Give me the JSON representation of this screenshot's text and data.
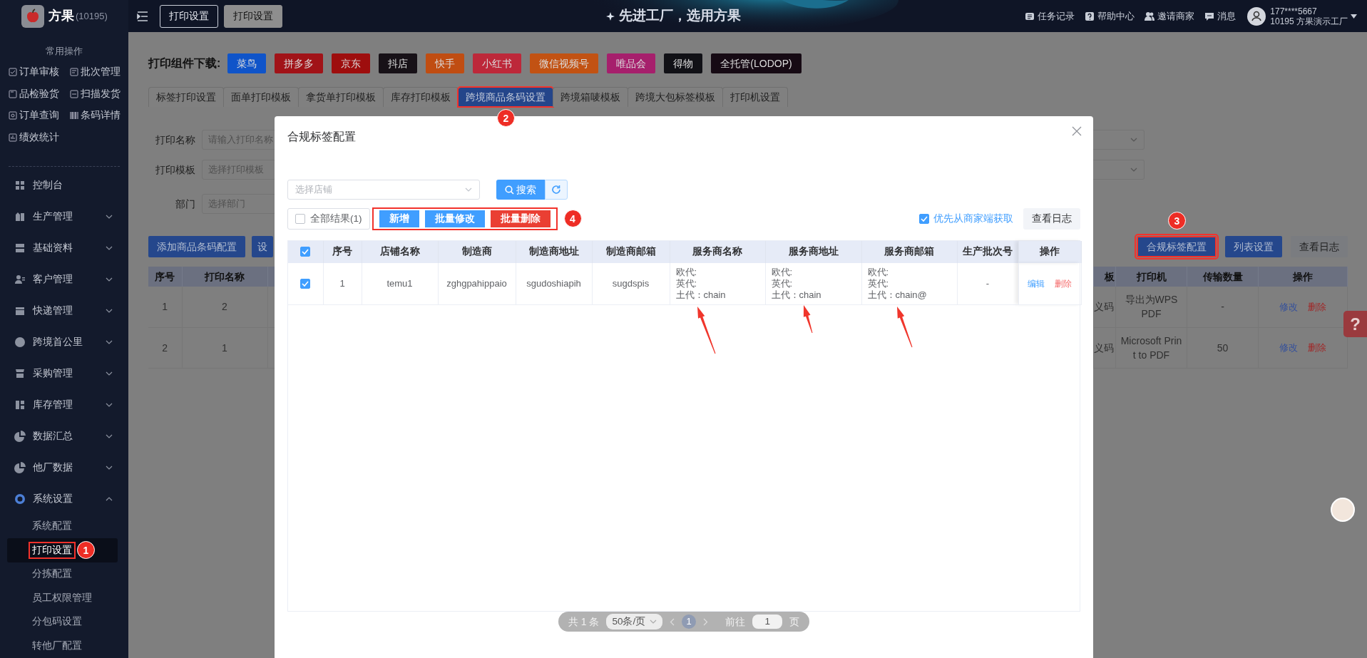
{
  "header": {
    "buttons": [
      {
        "label": "打印设置",
        "selected": false
      },
      {
        "label": "打印设置",
        "selected": true
      }
    ],
    "slogan": "先进工厂，选用方果",
    "links": [
      {
        "label": "任务记录",
        "kind": "tasks"
      },
      {
        "label": "帮助中心",
        "kind": "help"
      },
      {
        "label": "邀请商家",
        "kind": "invite"
      },
      {
        "label": "消息",
        "kind": "message"
      }
    ],
    "user": {
      "phone": "177****5667",
      "company": "10195 方果演示工厂"
    }
  },
  "sidebar": {
    "brand": "方果",
    "account": "(10195)",
    "quick_title": "常用操作",
    "quick_items": [
      {
        "label": "订单审核",
        "kind": "check"
      },
      {
        "label": "批次管理",
        "kind": "batch"
      },
      {
        "label": "品检验货",
        "kind": "inspect"
      },
      {
        "label": "扫描发货",
        "kind": "scan"
      },
      {
        "label": "订单查询",
        "kind": "search"
      },
      {
        "label": "条码详情",
        "kind": "barcode"
      },
      {
        "label": "绩效统计",
        "kind": "stats"
      }
    ],
    "menu": [
      {
        "label": "控制台",
        "kind": "dashboard"
      },
      {
        "label": "生产管理",
        "kind": "production",
        "expanded": false
      },
      {
        "label": "基础资料",
        "kind": "basic",
        "expanded": false
      },
      {
        "label": "客户管理",
        "kind": "customer",
        "expanded": false
      },
      {
        "label": "快递管理",
        "kind": "express",
        "expanded": false
      },
      {
        "label": "跨境首公里",
        "kind": "crossborder",
        "expanded": false
      },
      {
        "label": "采购管理",
        "kind": "purchase",
        "expanded": false
      },
      {
        "label": "库存管理",
        "kind": "inventory",
        "expanded": false
      },
      {
        "label": "数据汇总",
        "kind": "data",
        "expanded": false
      },
      {
        "label": "他厂数据",
        "kind": "data",
        "expanded": false
      },
      {
        "label": "系统设置",
        "kind": "system",
        "expanded": true,
        "children": [
          {
            "label": "系统配置",
            "selected": false,
            "highlighted": false
          },
          {
            "label": "打印设置",
            "selected": true,
            "highlighted": true,
            "badge": "1"
          },
          {
            "label": "分拣配置",
            "selected": false,
            "highlighted": false
          },
          {
            "label": "员工权限管理",
            "selected": false,
            "highlighted": false
          },
          {
            "label": "分包码设置",
            "selected": false,
            "highlighted": false
          },
          {
            "label": "转他厂配置",
            "selected": false,
            "highlighted": false
          }
        ]
      }
    ]
  },
  "page": {
    "download_label": "打印组件下载:",
    "download_buttons": [
      {
        "label": "菜鸟",
        "color": "#0f54c9"
      },
      {
        "label": "拼多多",
        "color": "#a11318"
      },
      {
        "label": "京东",
        "color": "#9e0e0e"
      },
      {
        "label": "抖店",
        "color": "#171117"
      },
      {
        "label": "快手",
        "color": "#c04d12"
      },
      {
        "label": "小红书",
        "color": "#bd283a"
      },
      {
        "label": "微信视频号",
        "color": "#c25213"
      },
      {
        "label": "唯品会",
        "color": "#a61f6c"
      },
      {
        "label": "得物",
        "color": "#111116"
      },
      {
        "label": "全托管(LODOP)",
        "color": "#160a14"
      }
    ],
    "tabs": [
      {
        "label": "标签打印设置",
        "selected": false,
        "highlighted": false
      },
      {
        "label": "面单打印模板",
        "selected": false,
        "highlighted": false
      },
      {
        "label": "拿货单打印模板",
        "selected": false,
        "highlighted": false
      },
      {
        "label": "库存打印模板",
        "selected": false,
        "highlighted": false
      },
      {
        "label": "跨境商品条码设置",
        "selected": true,
        "highlighted": true,
        "badge": "2"
      },
      {
        "label": "跨境箱唛模板",
        "selected": false,
        "highlighted": false
      },
      {
        "label": "跨境大包标签模板",
        "selected": false,
        "highlighted": false
      },
      {
        "label": "打印机设置",
        "selected": false,
        "highlighted": false
      }
    ],
    "form": [
      {
        "label": "打印名称",
        "placeholder": "请输入打印名称"
      },
      {
        "label": "打印模板",
        "placeholder": "选择打印模板"
      },
      {
        "label": "部门",
        "placeholder": "选择部门"
      }
    ],
    "left_buttons": [
      {
        "label": "添加商品条码配置",
        "highlighted": false
      },
      {
        "label": "设",
        "highlighted": false
      }
    ],
    "right_buttons": [
      {
        "label": "合规标签配置",
        "kind": "primary",
        "highlighted": true,
        "badge": "3"
      },
      {
        "label": "列表设置",
        "kind": "primary",
        "highlighted": false
      },
      {
        "label": "查看日志",
        "kind": "light",
        "highlighted": false
      }
    ],
    "table": {
      "columns": [
        "序号",
        "打印名称",
        "板",
        "打印机",
        "传输数量",
        "操作"
      ],
      "rows": [
        {
          "cells": [
            "1",
            "2",
            "义码",
            "导出为WPS PDF",
            "-"
          ],
          "actions": [
            {
              "label": "修改",
              "kind": "edit"
            },
            {
              "label": "删除",
              "kind": "delete"
            }
          ]
        },
        {
          "cells": [
            "2",
            "1",
            "义码",
            "Microsoft Print to PDF",
            "50"
          ],
          "actions": [
            {
              "label": "修改",
              "kind": "edit"
            },
            {
              "label": "删除",
              "kind": "delete"
            }
          ]
        }
      ]
    }
  },
  "modal": {
    "title": "合规标签配置",
    "store_select": {
      "placeholder": "选择店铺"
    },
    "search_button": "搜索",
    "all_results": {
      "label": "全部结果(1)",
      "checked": false
    },
    "bulk_actions": {
      "highlighted": true,
      "badge": "4",
      "buttons": [
        {
          "label": "新增",
          "kind": "primary"
        },
        {
          "label": "批量修改",
          "kind": "primary"
        },
        {
          "label": "批量删除",
          "kind": "danger"
        }
      ]
    },
    "prefer_merchant": {
      "label": "优先从商家端获取",
      "checked": true
    },
    "log_button": "查看日志",
    "table": {
      "all_checked": true,
      "columns": [
        "序号",
        "店铺名称",
        "制造商",
        "制造商地址",
        "制造商邮箱",
        "服务商名称",
        "服务商地址",
        "服务商邮箱",
        "生产批次号",
        "操作"
      ],
      "rows": [
        {
          "checked": true,
          "cells": [
            "1",
            "temu1",
            "zghgpahippaio",
            "sgudoshiapih",
            "sugdspis",
            "欧代:\n英代:\n土代：chain",
            "欧代:\n英代:\n土代：chain",
            "欧代:\n英代:\n土代：chain@",
            "-"
          ],
          "actions": [
            {
              "label": "编辑",
              "kind": "edit"
            },
            {
              "label": "删除",
              "kind": "delete"
            }
          ]
        }
      ]
    },
    "pagination": {
      "total": "共 1 条",
      "page_size": "50条/页",
      "pages": [
        {
          "label": "1",
          "selected": true
        }
      ],
      "goto_label": "前往",
      "goto_value": "1",
      "page_unit": "页"
    }
  },
  "help_tab": {
    "label": "?"
  }
}
